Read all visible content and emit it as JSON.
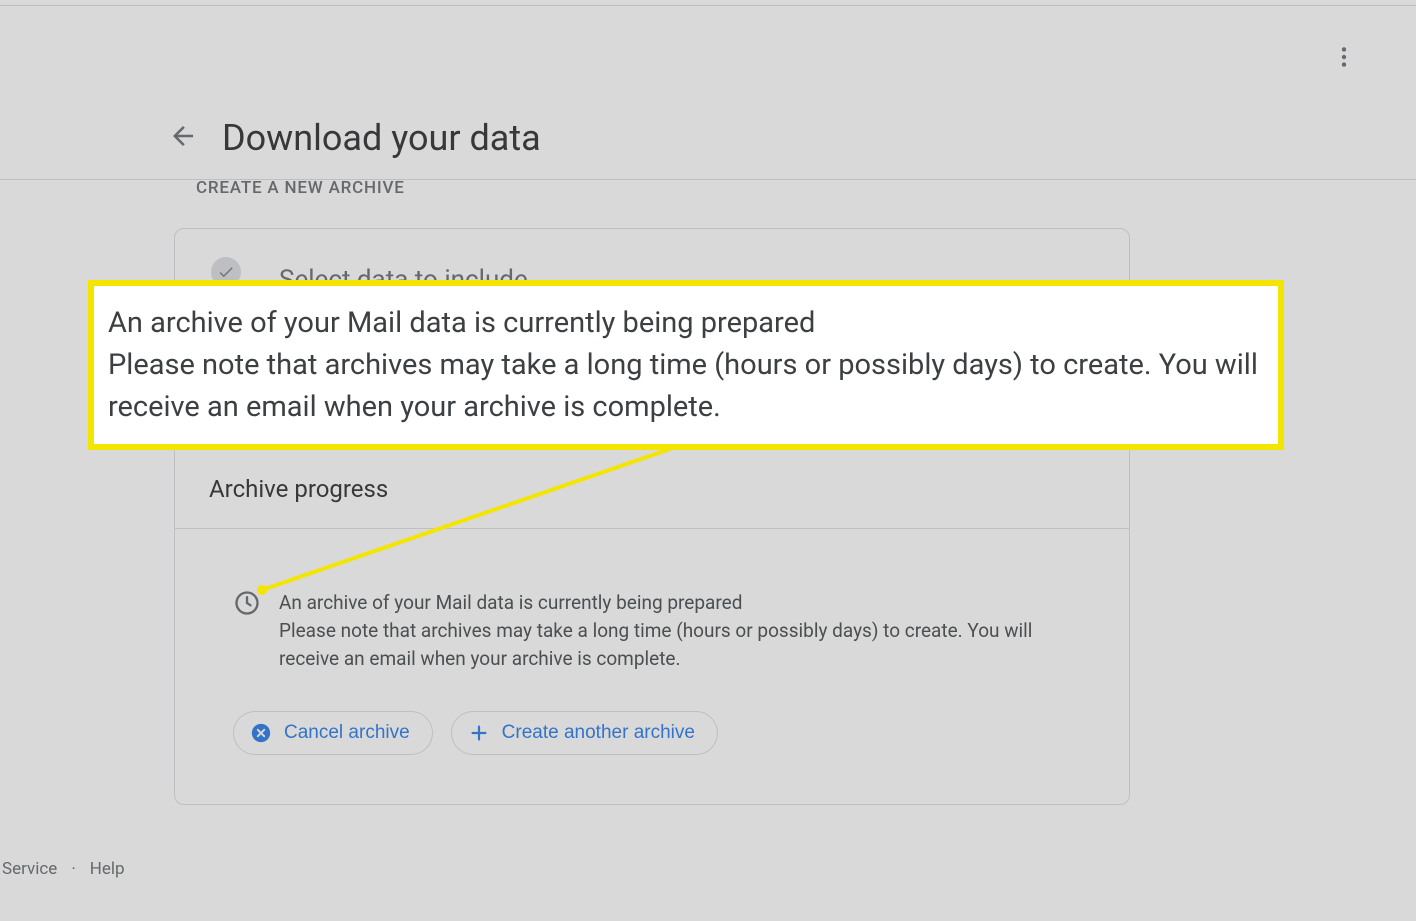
{
  "header": {
    "title": "Download your data"
  },
  "section": {
    "label": "CREATE A NEW ARCHIVE"
  },
  "step1": {
    "title": "Select data to include"
  },
  "progress": {
    "section_title": "Archive progress",
    "line1": "An archive of your Mail data is currently being prepared",
    "line2": "Please note that archives may take a long time (hours or possibly days) to create. You will receive an email when your archive is complete."
  },
  "buttons": {
    "cancel": "Cancel archive",
    "create_another": "Create another archive"
  },
  "footer": {
    "service": "Service",
    "help": "Help"
  },
  "callout": {
    "line1": "An archive of your Mail data is currently being prepared",
    "line2": "Please note that archives may take a long time (hours or possibly days) to create. You will receive an email when your archive is complete."
  },
  "colors": {
    "highlight": "#f4e500",
    "link": "#1a73e8"
  }
}
